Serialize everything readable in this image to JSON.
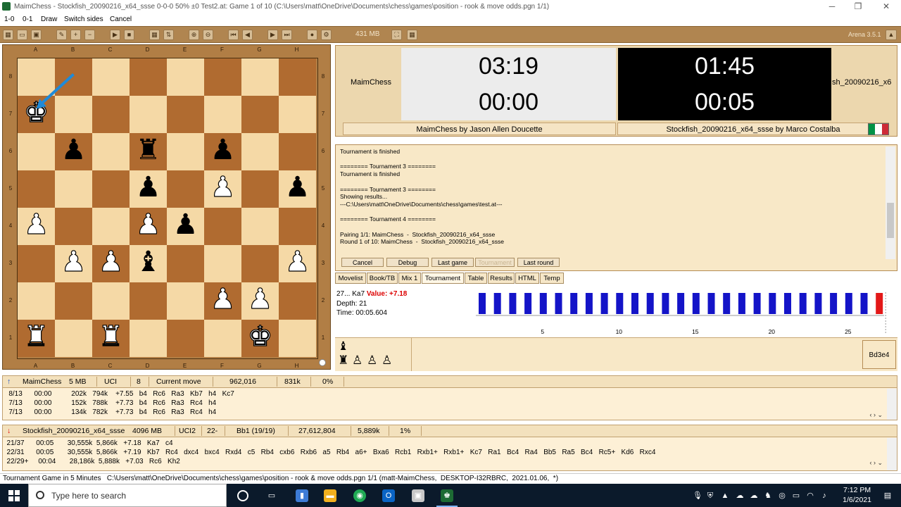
{
  "window": {
    "title": "MaimChess - Stockfish_20090216_x64_ssse   0-0-0  50%  ±0   Test2.at:  Game 1 of 10  (C:\\Users\\matt\\OneDrive\\Documents\\chess\\games\\position - rook & move odds.pgn 1/1)",
    "min_icon": "minimize-icon",
    "max_icon": "maximize-icon",
    "close_icon": "close-icon"
  },
  "menu": [
    "1-0",
    "0-1",
    "Draw",
    "Switch sides",
    "Cancel"
  ],
  "toolbar": {
    "memory": "431 MB",
    "version": "Arena 3.5.1"
  },
  "board": {
    "files": [
      "A",
      "B",
      "C",
      "D",
      "E",
      "F",
      "G",
      "H"
    ],
    "ranks": [
      "8",
      "7",
      "6",
      "5",
      "4",
      "3",
      "2",
      "1"
    ],
    "pieces": [
      {
        "sq": "a7",
        "glyph": "♚",
        "color": "w",
        "name": "white-king"
      },
      {
        "sq": "b6",
        "glyph": "♟",
        "color": "b",
        "name": "black-pawn"
      },
      {
        "sq": "d6",
        "glyph": "♜",
        "color": "b",
        "name": "black-rook"
      },
      {
        "sq": "f6",
        "glyph": "♟",
        "color": "b",
        "name": "black-pawn"
      },
      {
        "sq": "d5",
        "glyph": "♟",
        "color": "b",
        "name": "black-pawn"
      },
      {
        "sq": "f5",
        "glyph": "♟",
        "color": "w",
        "name": "white-pawn"
      },
      {
        "sq": "h5",
        "glyph": "♟",
        "color": "b",
        "name": "black-pawn"
      },
      {
        "sq": "a4",
        "glyph": "♟",
        "color": "w",
        "name": "white-pawn"
      },
      {
        "sq": "d4",
        "glyph": "♟",
        "color": "w",
        "name": "white-pawn"
      },
      {
        "sq": "e4",
        "glyph": "♟",
        "color": "b",
        "name": "black-pawn"
      },
      {
        "sq": "b3",
        "glyph": "♟",
        "color": "w",
        "name": "white-pawn"
      },
      {
        "sq": "c3",
        "glyph": "♟",
        "color": "w",
        "name": "white-pawn"
      },
      {
        "sq": "d3",
        "glyph": "♝",
        "color": "b",
        "name": "black-bishop"
      },
      {
        "sq": "h3",
        "glyph": "♟",
        "color": "w",
        "name": "white-pawn"
      },
      {
        "sq": "f2",
        "glyph": "♟",
        "color": "w",
        "name": "white-pawn"
      },
      {
        "sq": "g2",
        "glyph": "♟",
        "color": "w",
        "name": "white-pawn"
      },
      {
        "sq": "a1",
        "glyph": "♜",
        "color": "w",
        "name": "white-rook"
      },
      {
        "sq": "c1",
        "glyph": "♜",
        "color": "w",
        "name": "white-rook"
      },
      {
        "sq": "g1",
        "glyph": "♚",
        "color": "w",
        "name": "white-king"
      }
    ],
    "arrow": {
      "from": "b8",
      "to": "a7",
      "color": "#1f8ad8"
    }
  },
  "clocks": {
    "white_name": "MaimChess",
    "white_time": "03:19",
    "white_move_time": "00:00",
    "black_name": "sh_20090216_x6",
    "black_time": "01:45",
    "black_move_time": "00:05",
    "white_engine": "MaimChess by Jason Allen Doucette",
    "black_engine": "Stockfish_20090216_x64_ssse by Marco Costalba",
    "flag_colors": [
      "#009246",
      "#ffffff",
      "#ce2b37"
    ]
  },
  "log": {
    "text": "Tournament is finished\n\n======== Tournament 3 ========\nTournament is finished\n\n======== Tournament 3 ========\nShowing results...\n---C:\\Users\\matt\\OneDrive\\Documents\\chess\\games\\test.at---\n\n======== Tournament 4 ========\n\nPairing 1/1: MaimChess  -  Stockfish_20090216_x64_ssse\nRound 1 of 10: MaimChess  -  Stockfish_20090216_x64_ssse",
    "buttons": [
      "Cancel",
      "Debug",
      "Last game",
      "Tournament",
      "Last round"
    ]
  },
  "tabs": [
    "Movelist",
    "Book/TB",
    "Mix 1",
    "Tournament",
    "Table",
    "Results",
    "HTML",
    "Temp"
  ],
  "eval": {
    "move": "27... Ka7",
    "value_label": "Value: +7.18",
    "depth": "Depth: 21",
    "time": "Time: 00:05.604",
    "y_ticks": [
      "4",
      "2",
      "-2",
      "-4"
    ],
    "x_ticks": [
      "5",
      "10",
      "15",
      "20",
      "25"
    ]
  },
  "capture": {
    "pieces": [
      "♝",
      "♜",
      "♙",
      "♙",
      "♙"
    ],
    "last_move": "Bd3e4"
  },
  "engine1": {
    "name": "MaimChess",
    "mem": "5 MB",
    "proto": "UCI",
    "depth": "8",
    "current": "Current move",
    "nodes": "962,016",
    "nps": "831k",
    "load": "0%",
    "lines": "   8/13      00:00          202k   794k    +7.55   b4   Rc6   Ra3   Kb7   h4   Kc7\n   7/13      00:00          152k   788k    +7.73   b4   Rc6   Ra3   Rc4   h4\n   7/13      00:00          134k   782k    +7.73   b4   Rc6   Ra3   Rc4   h4"
  },
  "engine2": {
    "name": "Stockfish_20090216_x64_ssse",
    "mem": "4096 MB",
    "proto": "UCI2",
    "depth": "22-",
    "current": "Bb1 (19/19)",
    "nodes": "27,612,804",
    "nps": "5,889k",
    "load": "1%",
    "lines": "  21/37      00:05       30,555k  5,866k   +7.18   Ka7   c4\n  22/31      00:05       30,555k  5,866k   +7.19   Kb7   Rc4   dxc4   bxc4   Rxd4   c5   Rb4   cxb6   Rxb6   a5   Rb4   a6+   Bxa6   Rcb1   Rxb1+   Rxb1+   Kc7   Ra1   Bc4   Ra4   Bb5   Ra5   Bc4   Rc5+   Kd6   Rxc4\n  22/29+     00:04       28,186k  5,888k   +7.03   Rc6   Kh2"
  },
  "status": "Tournament Game in 5 Minutes   C:\\Users\\matt\\OneDrive\\Documents\\chess\\games\\position - rook & move odds.pgn 1/1 (matt-MaimChess,  DESKTOP-I32RBRC,  2021.01.06,  *)",
  "taskbar": {
    "search_placeholder": "Type here to search",
    "time": "7:12 PM",
    "date": "1/6/2021"
  }
}
